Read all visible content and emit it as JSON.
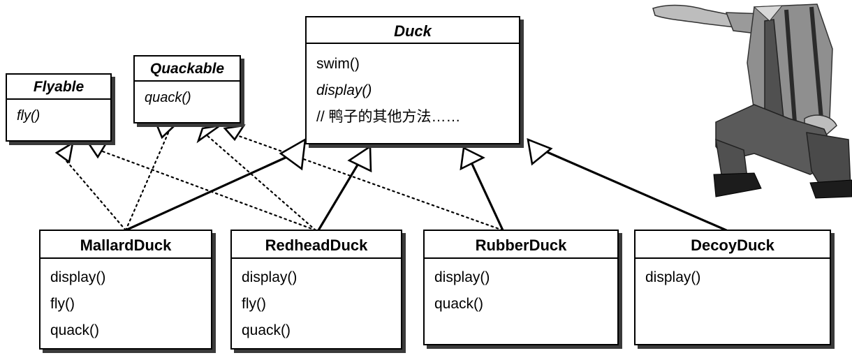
{
  "diagram": {
    "interfaces": [
      {
        "id": "flyable",
        "name": "Flyable",
        "methods": [
          {
            "text": "fly()",
            "italic": true
          }
        ]
      },
      {
        "id": "quackable",
        "name": "Quackable",
        "methods": [
          {
            "text": "quack()",
            "italic": true
          }
        ]
      }
    ],
    "superclass": {
      "name": "Duck",
      "methods": [
        {
          "text": "swim()",
          "italic": false
        },
        {
          "text": "display()",
          "italic": true
        },
        {
          "text": "// 鸭子的其他方法……",
          "italic": false
        }
      ]
    },
    "subclasses": [
      {
        "id": "mallard",
        "name": "MallardDuck",
        "methods": [
          "display()",
          "fly()",
          "quack()"
        ]
      },
      {
        "id": "redhead",
        "name": "RedheadDuck",
        "methods": [
          "display()",
          "fly()",
          "quack()"
        ]
      },
      {
        "id": "rubber",
        "name": "RubberDuck",
        "methods": [
          "display()",
          "quack()"
        ]
      },
      {
        "id": "decoy",
        "name": "DecoyDuck",
        "methods": [
          "display()"
        ]
      }
    ],
    "relationships": [
      {
        "from": "MallardDuck",
        "to": "Duck",
        "kind": "inheritance"
      },
      {
        "from": "RedheadDuck",
        "to": "Duck",
        "kind": "inheritance"
      },
      {
        "from": "RubberDuck",
        "to": "Duck",
        "kind": "inheritance"
      },
      {
        "from": "DecoyDuck",
        "to": "Duck",
        "kind": "inheritance"
      },
      {
        "from": "MallardDuck",
        "to": "Flyable",
        "kind": "realization"
      },
      {
        "from": "MallardDuck",
        "to": "Quackable",
        "kind": "realization"
      },
      {
        "from": "RedheadDuck",
        "to": "Flyable",
        "kind": "realization"
      },
      {
        "from": "RedheadDuck",
        "to": "Quackable",
        "kind": "realization"
      },
      {
        "from": "RubberDuck",
        "to": "Quackable",
        "kind": "realization"
      }
    ]
  },
  "colors": {
    "line": "#000000",
    "box_fill": "#ffffff",
    "shadow": "#3a3a3a"
  },
  "illustration": {
    "icon": "presenter-man-icon"
  }
}
